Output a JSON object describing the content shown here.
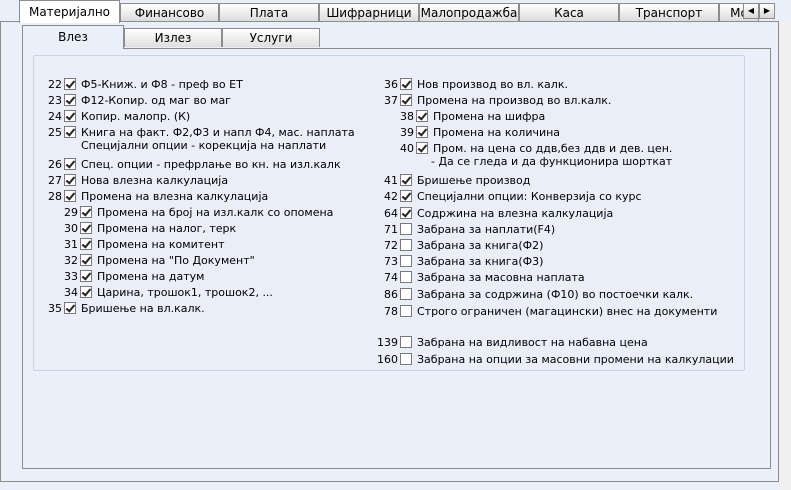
{
  "top_tabs": [
    {
      "label": "Материјално",
      "active": true
    },
    {
      "label": "Финансово",
      "active": false
    },
    {
      "label": "Плата",
      "active": false
    },
    {
      "label": "Шифрарници",
      "active": false
    },
    {
      "label": "Малопродажба",
      "active": false
    },
    {
      "label": "Каса",
      "active": false
    },
    {
      "label": "Транспорт",
      "active": false
    },
    {
      "label": "Мо",
      "active": false
    }
  ],
  "scroll_left": "◀",
  "scroll_right": "▶",
  "sub_tabs": [
    {
      "label": "Влез",
      "active": true
    },
    {
      "label": "Излез",
      "active": false
    },
    {
      "label": "Услуги",
      "active": false
    }
  ],
  "left_options": [
    {
      "num": "22",
      "label": "Ф5-Книж. и Ф8 - преф во ЕТ",
      "checked": true,
      "indent": false
    },
    {
      "num": "23",
      "label": "Ф12-Копир. од маг во маг",
      "checked": true,
      "indent": false
    },
    {
      "num": "24",
      "label": "Копир. малопр. (К)",
      "checked": true,
      "indent": false
    },
    {
      "num": "25",
      "label": "Книга на факт. Ф2,Ф3 и напл Ф4, мас. наплата",
      "checked": true,
      "indent": false
    },
    {
      "num": "26",
      "label": "Спец. опции - префрлање во кн. на изл.калк",
      "checked": true,
      "indent": false
    },
    {
      "num": "27",
      "label": "Нова влезна калкулација",
      "checked": true,
      "indent": false
    },
    {
      "num": "28",
      "label": "Промена на влезна калкулација",
      "checked": true,
      "indent": false
    },
    {
      "num": "29",
      "label": "Промена на број на изл.калк со опомена",
      "checked": true,
      "indent": true
    },
    {
      "num": "30",
      "label": "Промена на налог, терк",
      "checked": true,
      "indent": true
    },
    {
      "num": "31",
      "label": "Промена на комитент",
      "checked": true,
      "indent": true
    },
    {
      "num": "32",
      "label": "Промена на \"По Документ\"",
      "checked": true,
      "indent": true
    },
    {
      "num": "33",
      "label": "Промена на датум",
      "checked": true,
      "indent": true
    },
    {
      "num": "34",
      "label": "Царина, трошок1, трошок2, ...",
      "checked": true,
      "indent": true
    },
    {
      "num": "35",
      "label": "Бришење на вл.калк.",
      "checked": true,
      "indent": false
    }
  ],
  "left_note_25": "Специјални опции - корекција на наплати",
  "right_options": [
    {
      "num": "36",
      "label": "Нов производ во вл. калк.",
      "checked": true,
      "indent": false
    },
    {
      "num": "37",
      "label": "Промена на производ во вл.калк.",
      "checked": true,
      "indent": false
    },
    {
      "num": "38",
      "label": "Промена на шифра",
      "checked": true,
      "indent": true
    },
    {
      "num": "39",
      "label": "Промена на количина",
      "checked": true,
      "indent": true
    },
    {
      "num": "40",
      "label": "Пром. на цена со ддв,без ддв и дев. цен.",
      "checked": true,
      "indent": true
    },
    {
      "num": "41",
      "label": "Бришење производ",
      "checked": true,
      "indent": false
    },
    {
      "num": "42",
      "label": "Специјални опции: Конверзија со курс",
      "checked": true,
      "indent": false
    },
    {
      "num": "64",
      "label": "Содржина на влезна калкулација",
      "checked": true,
      "indent": false
    },
    {
      "num": "71",
      "label": "Забрана за наплати(F4)",
      "checked": false,
      "indent": false
    },
    {
      "num": "72",
      "label": "Забрана за книга(Ф2)",
      "checked": false,
      "indent": false
    },
    {
      "num": "73",
      "label": "Забрана за книга(Ф3)",
      "checked": false,
      "indent": false
    },
    {
      "num": "74",
      "label": "Забрана за масовна наплата",
      "checked": false,
      "indent": false
    },
    {
      "num": "86",
      "label": "Забрана за содржина (Ф10) во постоечки калк.",
      "checked": false,
      "indent": false
    },
    {
      "num": "78",
      "label": "Строго ограничен (магацински) внес на документи",
      "checked": false,
      "indent": false
    },
    {
      "num": "139",
      "label": "Забрана на видливост на набавна цена",
      "checked": false,
      "indent": false
    },
    {
      "num": "160",
      "label": "Забрана на опции за масовни промени на калкулации",
      "checked": false,
      "indent": false
    }
  ],
  "right_note_40": "- Да се гледа и да функционира шорткат"
}
